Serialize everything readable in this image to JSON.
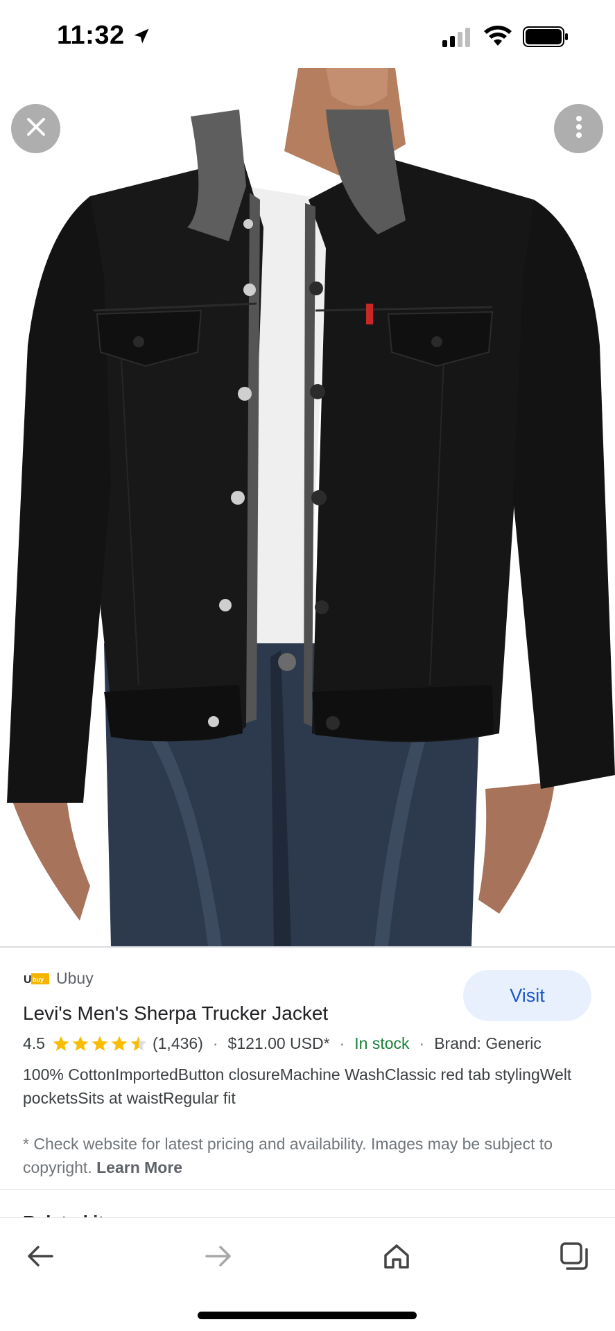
{
  "status_bar": {
    "time": "11:32",
    "icons": [
      "location-arrow-icon",
      "signal-icon",
      "wifi-icon",
      "battery-icon"
    ]
  },
  "image_viewer": {
    "alt": "Levi's Men's Sherpa Trucker Jacket",
    "close_icon": "close-icon",
    "more_icon": "more-vert-icon"
  },
  "product": {
    "source_logo_text": "Ubuy",
    "source_name": "Ubuy",
    "title": "Levi's Men's Sherpa Trucker Jacket",
    "rating": "4.5",
    "rating_value": 4.5,
    "rating_max": 5,
    "review_count": "(1,436)",
    "price": "$121.00 USD*",
    "stock": "In stock",
    "brand": "Brand: Generic",
    "description": "100% CottonImportedButton closureMachine WashClassic red tab stylingWelt pocketsSits at waistRegular fit",
    "visit_label": "Visit",
    "disclaimer": "* Check website for latest pricing and availability. Images may be subject to copyright.",
    "learn_more": "Learn More",
    "next_section_peek": "Related items"
  },
  "toolbar": {
    "items": [
      "back-arrow-icon",
      "forward-arrow-icon",
      "home-icon",
      "tabs-icon"
    ]
  },
  "colors": {
    "accent": "#1a57c8",
    "visit_bg": "#e8f0fe",
    "in_stock": "#188038",
    "star": "#fbbc04",
    "star_empty": "#dadce0",
    "jacket": "#161616",
    "collar": "#5e5e5e",
    "denim": "#2d3a4d"
  }
}
